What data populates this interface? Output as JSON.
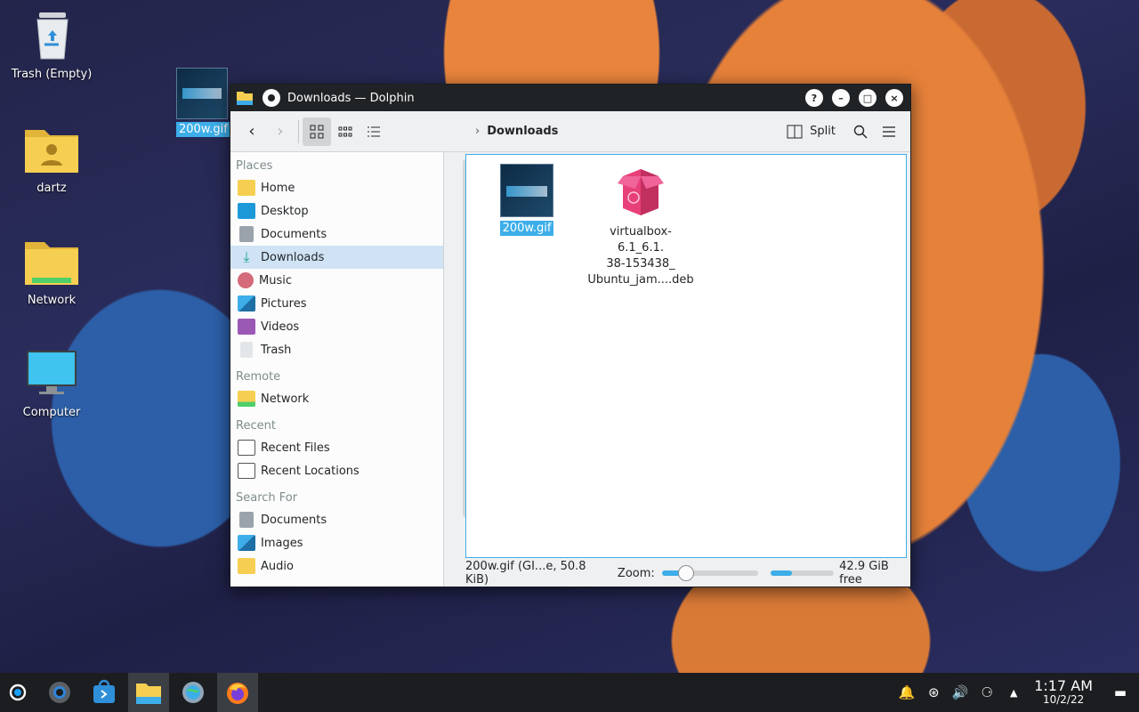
{
  "desktop": {
    "icons": [
      {
        "label": "Trash (Empty)"
      },
      {
        "label": "dartz"
      },
      {
        "label": "Network"
      },
      {
        "label": "Computer"
      }
    ],
    "dragged_file": "200w.gif"
  },
  "window": {
    "title": "Downloads — Dolphin",
    "buttons": {
      "help": "?",
      "minimize": "–",
      "maximize": "□",
      "close": "×"
    }
  },
  "toolbar": {
    "breadcrumb": "Downloads",
    "split_label": "Split"
  },
  "sidebar": {
    "places_header": "Places",
    "places": [
      {
        "label": "Home"
      },
      {
        "label": "Desktop"
      },
      {
        "label": "Documents"
      },
      {
        "label": "Downloads"
      },
      {
        "label": "Music"
      },
      {
        "label": "Pictures"
      },
      {
        "label": "Videos"
      },
      {
        "label": "Trash"
      }
    ],
    "remote_header": "Remote",
    "remote": [
      {
        "label": "Network"
      }
    ],
    "recent_header": "Recent",
    "recent": [
      {
        "label": "Recent Files"
      },
      {
        "label": "Recent Locations"
      }
    ],
    "search_header": "Search For",
    "search": [
      {
        "label": "Documents"
      },
      {
        "label": "Images"
      },
      {
        "label": "Audio"
      }
    ]
  },
  "files": [
    {
      "name": "200w.gif"
    },
    {
      "name_line1": "virtualbox-6.1_6.1.",
      "name_line2": "38-153438_",
      "name_line3": "Ubuntu_jam....deb"
    }
  ],
  "status": {
    "selection": "200w.gif (GI...e, 50.8 KiB)",
    "zoom_label": "Zoom:",
    "zoom_level": 0.25,
    "disk_used_fraction": 0.33,
    "free_space": "42.9 GiB free"
  },
  "taskbar": {
    "time": "1:17 AM",
    "date": "10/2/22"
  },
  "colors": {
    "accent": "#3daee9",
    "selection": "#cfe3f5",
    "titlebar": "#202326"
  }
}
